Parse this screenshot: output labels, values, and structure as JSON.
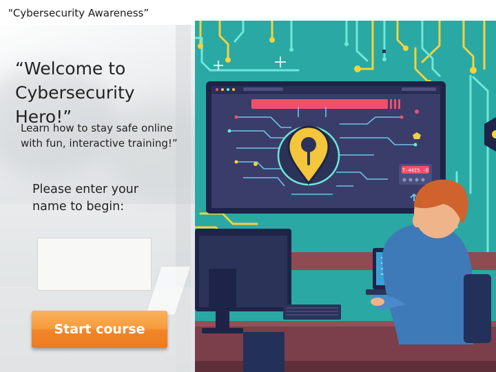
{
  "window": {
    "title": "\"Cybersecurity Awareness”"
  },
  "content": {
    "welcome_line1": "“Welcome to",
    "welcome_line2": "Cybersecurity Hero!”",
    "subtitle": "Learn how to stay safe online with fun, interactive training!”",
    "prompt": "Please enter your name to begin:",
    "name_input": {
      "value": "",
      "placeholder": ""
    },
    "start_button": "Start course"
  },
  "illustration": {
    "screen_badge": "T-44I5 -O",
    "colors": {
      "background": "#2aa8a4",
      "circuit_yellow": "#f2d43a",
      "circuit_cyan": "#6ee8d8",
      "monitor_screen": "#3a3d6a",
      "alert_bar": "#f0506a",
      "lock_pin": "#f3c63b",
      "desk": "#7a3f4a",
      "wall_shelf": "#8f4a52",
      "hair": "#d0622e",
      "shirt": "#3e7ab8",
      "chair": "#23305a"
    },
    "icons": [
      "location-lock-icon",
      "alert-bar-icon",
      "arrow-up-icon",
      "plus-sparkle-icon"
    ]
  },
  "theme": {
    "button_orange": "#f69b3c",
    "text": "#222222"
  }
}
